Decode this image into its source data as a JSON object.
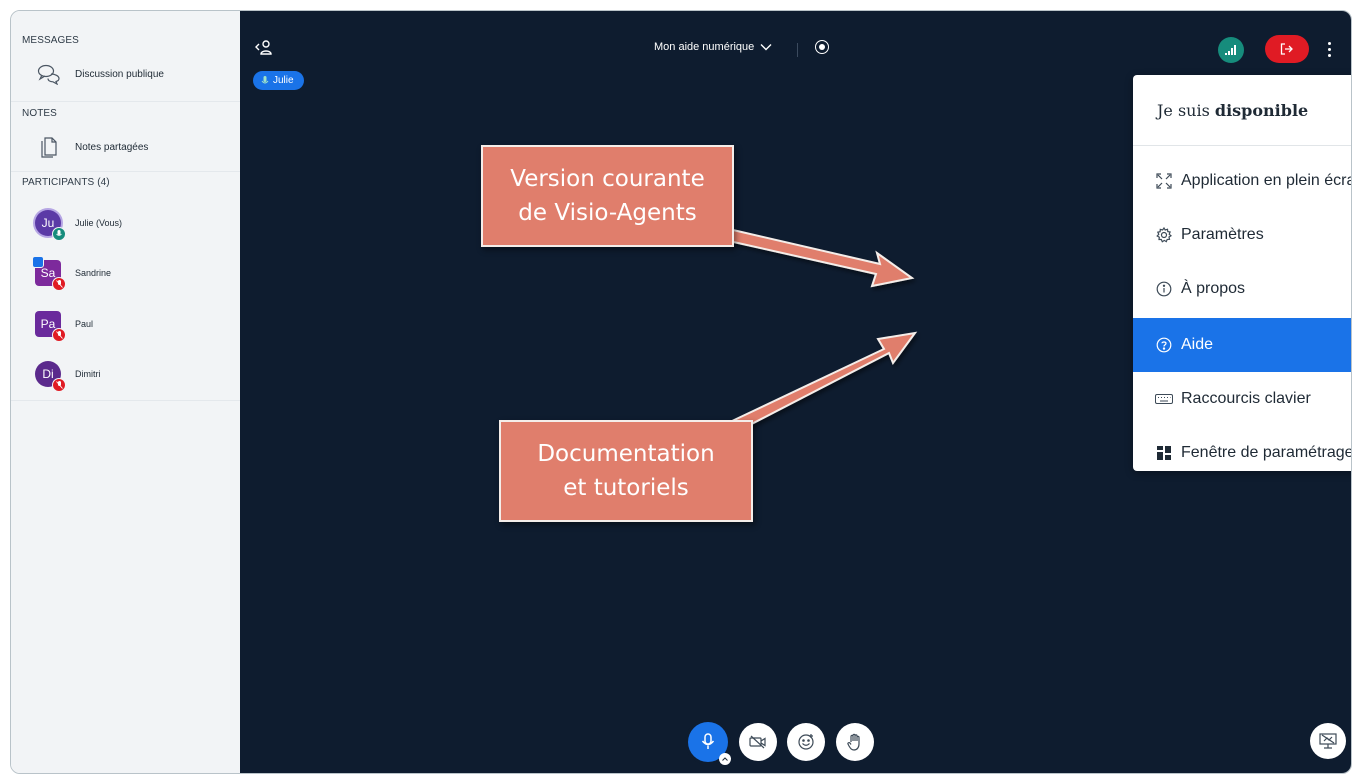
{
  "sidebar": {
    "messages_heading": "MESSAGES",
    "public_chat": "Discussion publique",
    "notes_heading": "NOTES",
    "shared_notes": "Notes partagées",
    "participants_heading": "PARTICIPANTS (4)",
    "participants": [
      {
        "initials": "Ju",
        "name": "Julie (Vous)",
        "color": "#5b3aa6",
        "mic": "on"
      },
      {
        "initials": "Sa",
        "name": "Sandrine",
        "color": "#7d2a9c",
        "mic": "off"
      },
      {
        "initials": "Pa",
        "name": "Paul",
        "color": "#6a2a9c",
        "mic": "off"
      },
      {
        "initials": "Di",
        "name": "Dimitri",
        "color": "#5b2a8c",
        "mic": "off"
      }
    ]
  },
  "topbar": {
    "meeting_title": "Mon aide numérique",
    "speaker_chip": "Julie"
  },
  "menu": {
    "availability_prefix": "Je suis",
    "availability_state": "disponible",
    "availability_on": true,
    "items": [
      {
        "label": "Application en plein écran",
        "icon": "fullscreen-icon"
      },
      {
        "label": "Paramètres",
        "icon": "gear-icon"
      },
      {
        "label": "À propos",
        "icon": "info-icon"
      },
      {
        "label": "Aide",
        "icon": "help-icon",
        "active": true
      },
      {
        "label": "Raccourcis clavier",
        "icon": "keyboard-icon"
      },
      {
        "label": "Fenêtre de paramétrage de la mise en page",
        "icon": "layout-icon"
      }
    ]
  },
  "annotations": {
    "callout_version_line1": "Version courante",
    "callout_version_line2": "de Visio-Agents",
    "callout_docs_line1": "Documentation",
    "callout_docs_line2": "et tutoriels"
  },
  "colors": {
    "stage_bg": "#0e1c2f",
    "accent_blue": "#1a73e8",
    "leave_red": "#e01b24",
    "toggle_green": "#127b70",
    "callout": "#e07e6c"
  }
}
